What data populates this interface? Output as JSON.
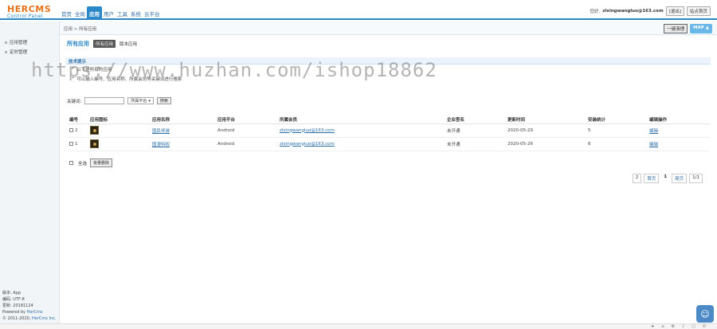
{
  "header": {
    "logo_main": "HERCMS",
    "logo_sub": "Control Panel",
    "nav": [
      "首页",
      "全局",
      "应用",
      "用户",
      "工具",
      "系统",
      "云平台"
    ],
    "nav_active": 2,
    "greeting": "您好,",
    "username": "zlxingwangluo@163.com",
    "logout": "[退出]",
    "site_home": "站点首页"
  },
  "subbar": {
    "breadcrumb": "应用 > 所有应用",
    "clear_cache": "一键清理",
    "map": "MAP ▲"
  },
  "sidebar": {
    "items": [
      "应用管理",
      "定时管理"
    ],
    "info": {
      "version": "版本: App",
      "charset": "编码: UTF-8",
      "update": "更新: 20181124",
      "powered_prefix": "Powered by ",
      "powered_brand": "HerCms",
      "copyright_prefix": "© 2011-2020, ",
      "copyright_brand": "HerCms Inc."
    }
  },
  "main": {
    "title": "所有应用",
    "tab_active": "所有应用",
    "tab_other": "版本应用",
    "tips_title": "技术提示",
    "tips": [
      "以下是所有的应用",
      "可以输入编号、应用名称、所属会员等关键词进行搜索"
    ],
    "search": {
      "label": "关键词:",
      "placeholder": "",
      "select_value": "所属平台",
      "button": "搜索"
    },
    "columns": [
      "编号",
      "应用图标",
      "应用名称",
      "应用平台",
      "所属会员",
      "企业签名",
      "更新时间",
      "安装统计",
      "编辑操作"
    ],
    "rows": [
      {
        "id": "2",
        "name": "国民伴游",
        "platform": "Android",
        "member": "zlxingwangluo@163.com",
        "sign": "未开通",
        "updated": "2020-05-29",
        "installs": "5",
        "action": "编辑"
      },
      {
        "id": "1",
        "name": "国漫特权",
        "platform": "Android",
        "member": "zlxingwangluo@163.com",
        "sign": "未开通",
        "updated": "2020-05-26",
        "installs": "6",
        "action": "编辑"
      }
    ],
    "select_all": "全选",
    "bulk_delete": "批量删除",
    "pager": [
      "2",
      "首页",
      "1",
      "尾页",
      "1/1"
    ]
  },
  "watermark": "https://www.huzhan.com/ishop18862",
  "colors": {
    "accent": "#2a87c8",
    "logo": "#e8731b"
  }
}
